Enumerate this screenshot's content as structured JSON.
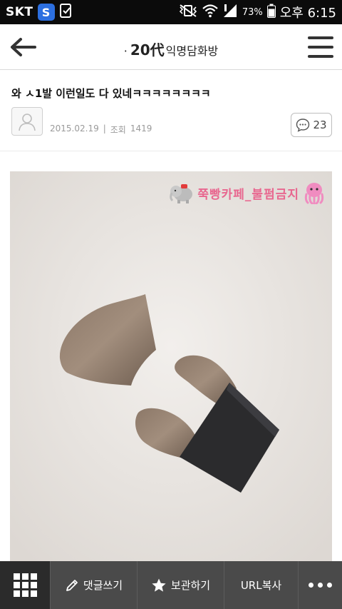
{
  "status_bar": {
    "carrier": "SKT",
    "carrier_badge": "S",
    "battery": "73%",
    "time": "오후 6:15"
  },
  "header": {
    "title_dot": "·",
    "title_main": "20代",
    "title_sub": "익명담화방"
  },
  "post": {
    "title": "와 ㅅ1발 이런일도 다 있네ㅋㅋㅋㅋㅋㅋㅋㅋ",
    "date": "2015.02.19",
    "views_label": "조회",
    "views": "1419",
    "comment_count": "23"
  },
  "photo": {
    "watermark": "쭉빵카페_불펌금지"
  },
  "toolbar": {
    "write_label": "댓글쓰기",
    "save_label": "보관하기",
    "url_label": "URL복사"
  },
  "colors": {
    "toolbar_bg": "#4a4a4a",
    "grid_bg": "#2b2b2b",
    "watermark": "#e8678f",
    "status_badge": "#2c6fe0"
  }
}
